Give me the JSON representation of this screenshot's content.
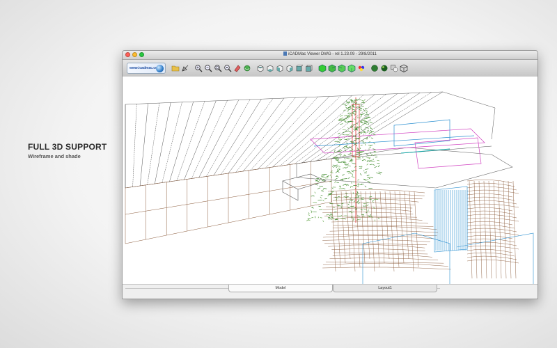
{
  "promo": {
    "headline": "FULL 3D SUPPORT",
    "subline": "Wireframe and shade"
  },
  "window": {
    "title": "iCADMac Viewer DWG - rel 1.23.09 - 29/8/2011",
    "logo_text": "www.icadmac.com"
  },
  "toolbar": {
    "icons": [
      "open-icon",
      "select-icon",
      "zoom-in-icon",
      "zoom-out-icon",
      "zoom-window-icon",
      "zoom-extents-icon",
      "pan-icon",
      "orbit-icon",
      "view-top-icon",
      "view-bottom-icon",
      "view-left-icon",
      "view-right-icon",
      "view-front-icon",
      "view-back-icon",
      "iso-sw-icon",
      "iso-se-icon",
      "iso-ne-icon",
      "iso-nw-icon",
      "layers-icon",
      "wireframe-icon",
      "shade-icon",
      "render-icon",
      "cube-icon"
    ]
  },
  "tabs": [
    {
      "label": "Model"
    },
    {
      "label": "Layout1"
    }
  ],
  "colors": {
    "wire_brown": "#8a5a3a",
    "wire_gray": "#555555",
    "wire_blue": "#2a8fd0",
    "tree_green": "#3f8a2e",
    "accent_magenta": "#d040c0",
    "accent_red": "#e03030"
  }
}
